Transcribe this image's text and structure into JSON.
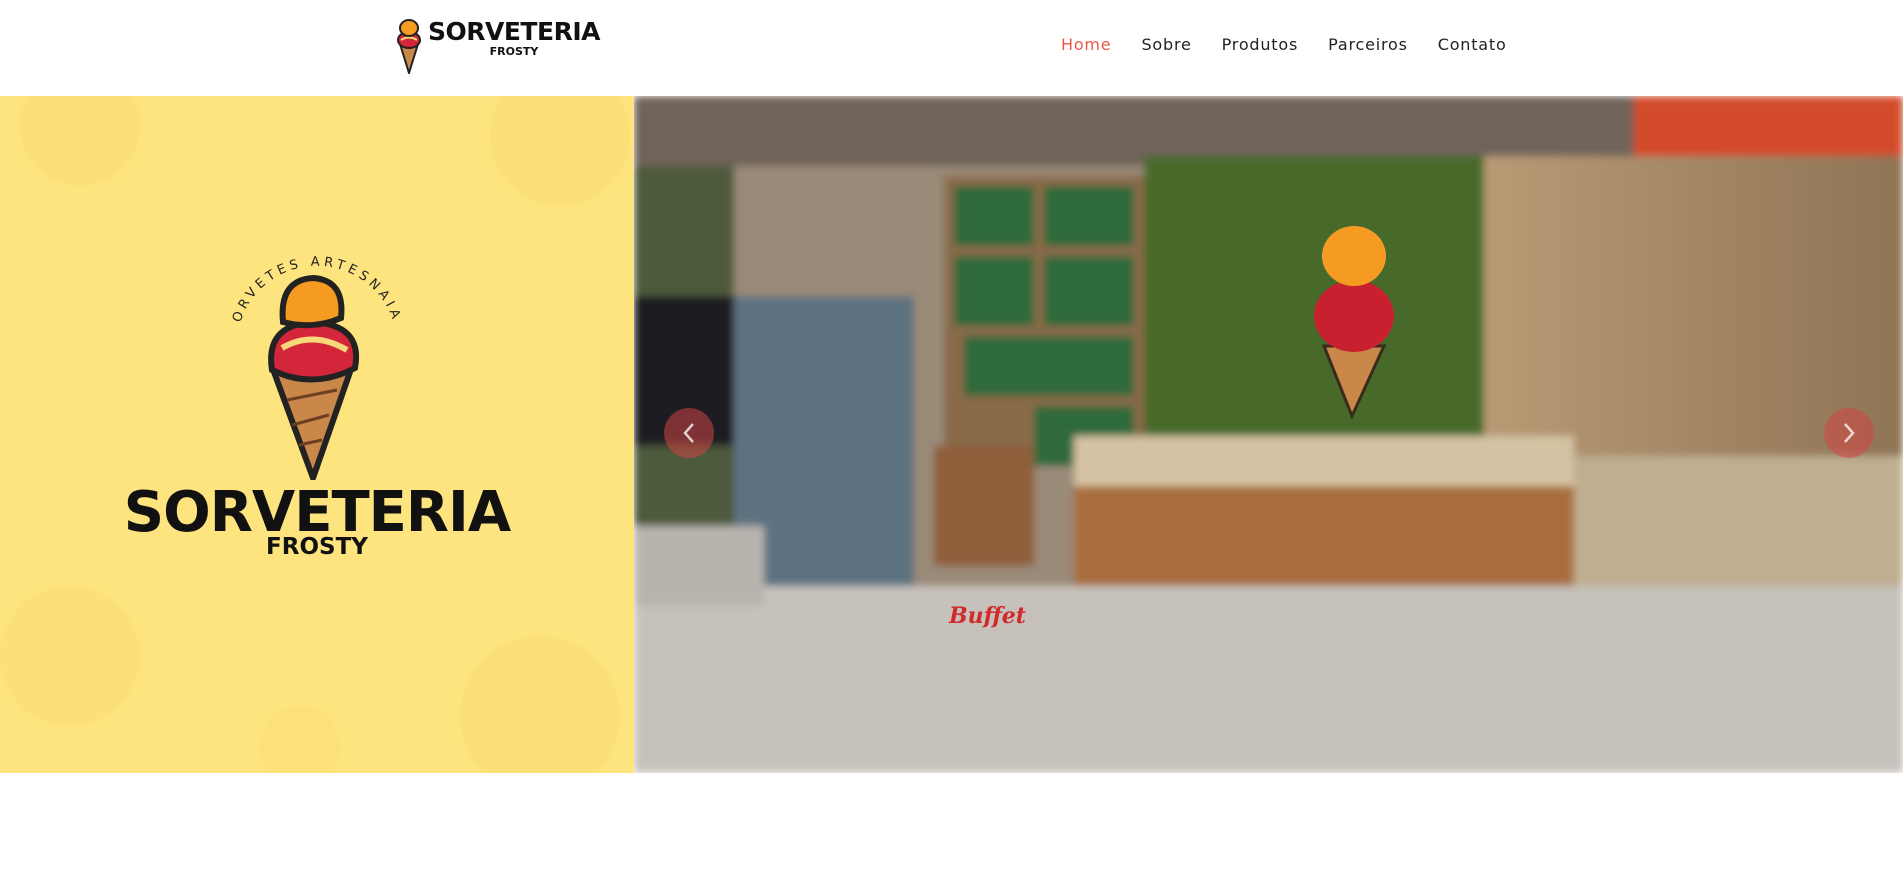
{
  "brand": {
    "name": "SORVETERIA",
    "sub": "FROSTY",
    "tagline": "SORVETES ARTESNAIAS"
  },
  "nav": {
    "items": [
      {
        "label": "Home",
        "active": true
      },
      {
        "label": "Sobre",
        "active": false
      },
      {
        "label": "Produtos",
        "active": false
      },
      {
        "label": "Parceiros",
        "active": false
      },
      {
        "label": "Contato",
        "active": false
      }
    ]
  },
  "hero": {
    "title": "SORVETERIA",
    "subtitle": "FROSTY",
    "prev_icon": "chevron-left-icon",
    "next_icon": "chevron-right-icon",
    "storefront_sign": "Buffet"
  },
  "colors": {
    "accent": "#e8594b",
    "hero_bg": "#fde47e",
    "text": "#111111"
  }
}
